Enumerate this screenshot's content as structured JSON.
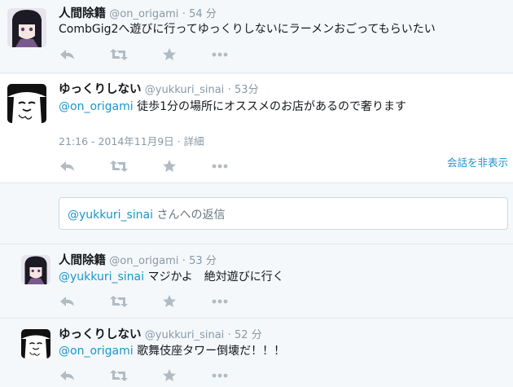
{
  "tweets": [
    {
      "name": "人間除籍",
      "handle": "@on_origami",
      "time": "54 分",
      "text": "CombGig2へ遊びに行ってゆっくりしないにラーメンおごってもらいたい"
    },
    {
      "name": "ゆっくりしない",
      "handle": "@yukkuri_sinai",
      "time": "53分",
      "mention": "@on_origami",
      "text": " 徒歩1分の場所にオススメのお店があるので奢ります",
      "timestamp": "21:16 - 2014年11月9日",
      "details_link": "詳細",
      "hide_conversation": "会話を非表示"
    },
    {
      "name": "人間除籍",
      "handle": "@on_origami",
      "time": "53 分",
      "mention": "@yukkuri_sinai",
      "text": " マジかよ　絶対遊びに行く"
    },
    {
      "name": "ゆっくりしない",
      "handle": "@yukkuri_sinai",
      "time": "52 分",
      "mention": "@on_origami",
      "text": " 歌舞伎座タワー倒壊だ！！！"
    }
  ],
  "reply_box": {
    "mention": "@yukkuri_sinai",
    "suffix": " さんへの返信"
  },
  "separator": "·",
  "icons": [
    "reply-icon",
    "retweet-icon",
    "favorite-icon",
    "more-icon"
  ],
  "colors": {
    "link": "#1b95c9",
    "muted": "#8899a6",
    "icon": "#b1bbc3"
  }
}
